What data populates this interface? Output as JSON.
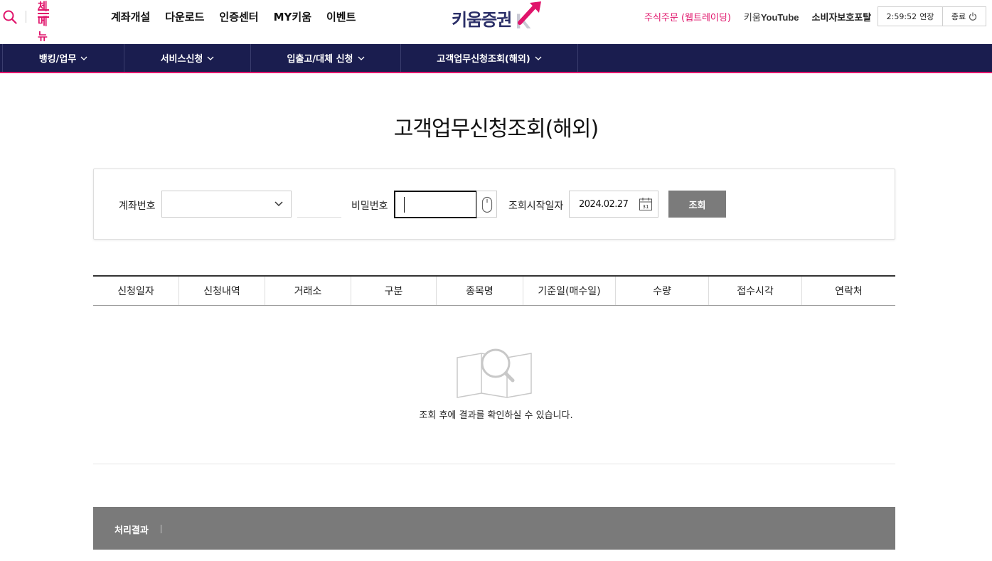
{
  "header": {
    "all_menu_label": "전체메뉴",
    "nav": [
      "계좌개설",
      "다운로드",
      "인증센터",
      "MY키움",
      "이벤트"
    ],
    "logo_text": "키움증권",
    "links": {
      "trade": "주식주문 (웹트레이딩)",
      "youtube_prefix": "키움",
      "youtube_suffix": "YouTube",
      "portal": "소비자보호포탈"
    },
    "session": {
      "time": "2:59:52",
      "extend_label": "연장",
      "logout_label": "종료"
    }
  },
  "gnb": {
    "items": [
      "뱅킹/업무",
      "서비스신청",
      "입출고/대체 신청",
      "고객업무신청조회(해외)"
    ]
  },
  "page": {
    "title": "고객업무신청조회(해외)"
  },
  "search_form": {
    "account_label": "계좌번호",
    "account_value": "",
    "password_label": "비밀번호",
    "start_date_label": "조회시작일자",
    "start_date_value": "2024.02.27",
    "calendar_day": "31",
    "query_button": "조회"
  },
  "table": {
    "columns": [
      "신청일자",
      "신청내역",
      "거래소",
      "구분",
      "종목명",
      "기준일(매수일)",
      "수량",
      "접수시각",
      "연락처"
    ]
  },
  "empty_state": {
    "message": "조회 후에 결과를 확인하실 수 있습니다."
  },
  "result": {
    "label": "처리결과"
  },
  "colors": {
    "accent": "#e0146b",
    "navy": "#1a1d4f",
    "button_gray": "#7b7b7b"
  }
}
